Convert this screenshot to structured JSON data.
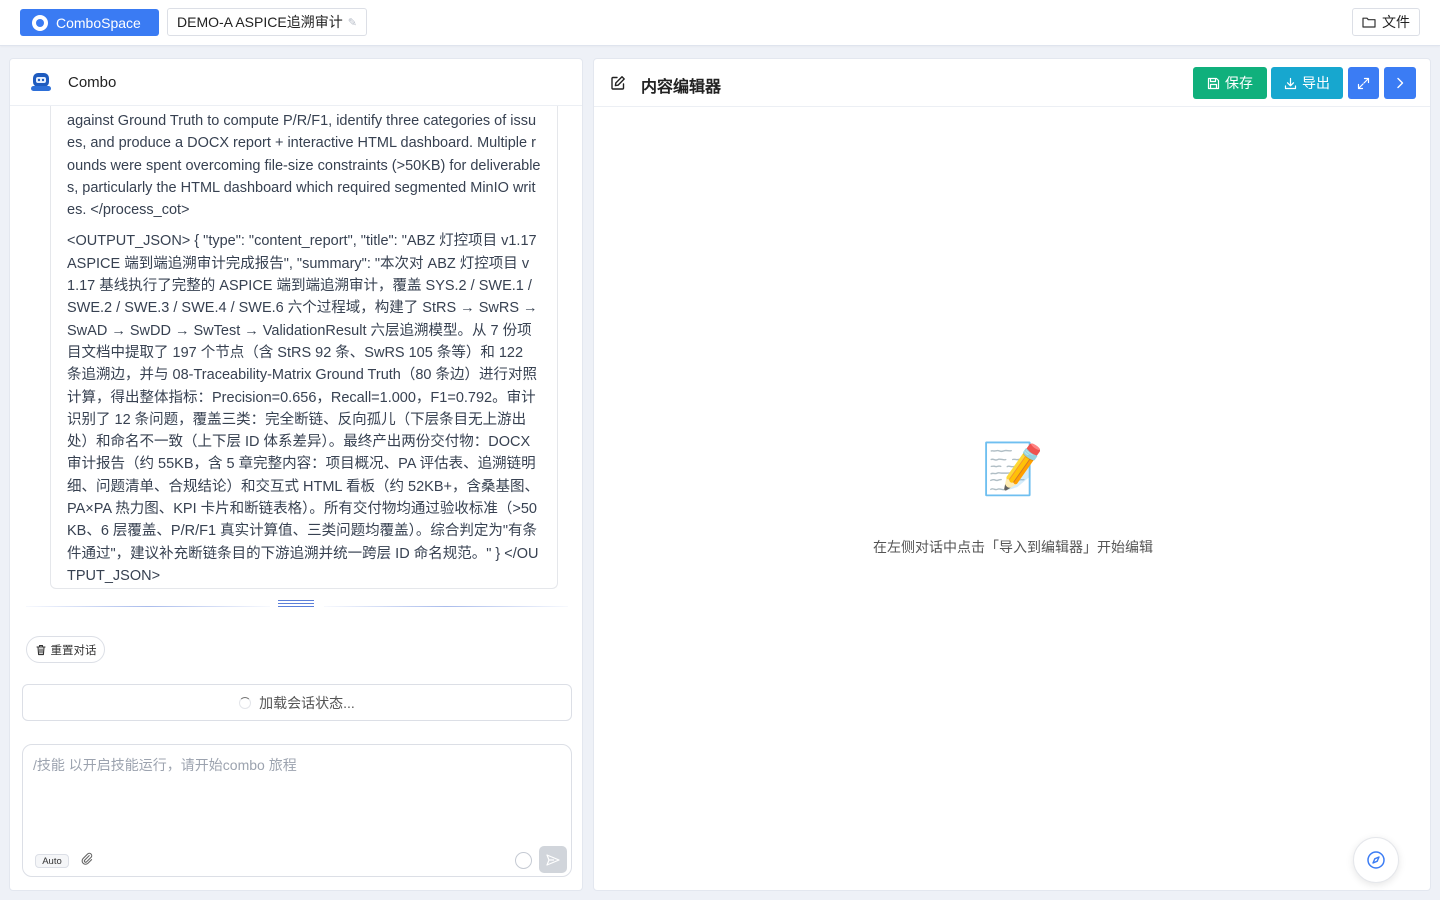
{
  "topbar": {
    "brand_label": "ComboSpace",
    "project_name": "DEMO-A ASPICE追溯审计",
    "project_edit_glyph": "✎",
    "files_label": "文件"
  },
  "chat": {
    "agent_name": "Combo",
    "messages": [
      "against Ground Truth to compute P/R/F1, identify three categories of issues, and produce a DOCX report + interactive HTML dashboard. Multiple rounds were spent overcoming file-size constraints (>50KB) for deliverables, particularly the HTML dashboard which required segmented MinIO writes. </process_cot>",
      "<OUTPUT_JSON> { \"type\": \"content_report\", \"title\": \"ABZ 灯控项目 v1.17 ASPICE 端到端追溯审计完成报告\", \"summary\": \"本次对 ABZ 灯控项目 v1.17 基线执行了完整的 ASPICE 端到端追溯审计，覆盖 SYS.2 / SWE.1 / SWE.2 / SWE.3 / SWE.4 / SWE.6 六个过程域，构建了 StRS → SwRS → SwAD → SwDD → SwTest → ValidationResult 六层追溯模型。从 7 份项目文档中提取了 197 个节点（含 StRS 92 条、SwRS 105 条等）和 122 条追溯边，并与 08-Traceability-Matrix Ground Truth（80 条边）进行对照计算，得出整体指标：Precision=0.656，Recall=1.000，F1=0.792。审计识别了 12 条问题，覆盖三类：完全断链、反向孤儿（下层条目无上游出处）和命名不一致（上下层 ID 体系差异）。最终产出两份交付物：DOCX 审计报告（约 55KB，含 5 章完整内容：项目概况、PA 评估表、追溯链明细、问题清单、合规结论）和交互式 HTML 看板（约 52KB+，含桑基图、PA×PA 热力图、KPI 卡片和断链表格）。所有交付物均通过验收标准（>50KB、6 层覆盖、P/R/F1 真实计算值、三类问题均覆盖）。综合判定为\"有条件通过\"，建议补充断链条目的下游追溯并统一跨层 ID 命名规范。\" } </OUTPUT_JSON>"
    ],
    "reset_label": "重置对话",
    "loading_text": "加载会话状态...",
    "input_placeholder": "/技能 以开启技能运行，请开始combo 旅程",
    "input_value": "",
    "mode_badge": "Auto"
  },
  "editor": {
    "title": "内容编辑器",
    "save_label": "保存",
    "export_label": "导出",
    "empty_emoji": "📝",
    "empty_hint": "在左侧对话中点击「导入到编辑器」开始编辑"
  },
  "colors": {
    "brand": "#3a7bf3",
    "save": "#10b07c",
    "export": "#17a7cf",
    "primary": "#3b7cf4"
  },
  "icons": [
    "folder-icon",
    "bot-avatar-icon",
    "trash-icon",
    "paperclip-icon",
    "send-icon",
    "edit-icon",
    "save-icon",
    "download-icon",
    "expand-icon",
    "chevron-right-icon",
    "compass-icon",
    "memo-icon"
  ]
}
